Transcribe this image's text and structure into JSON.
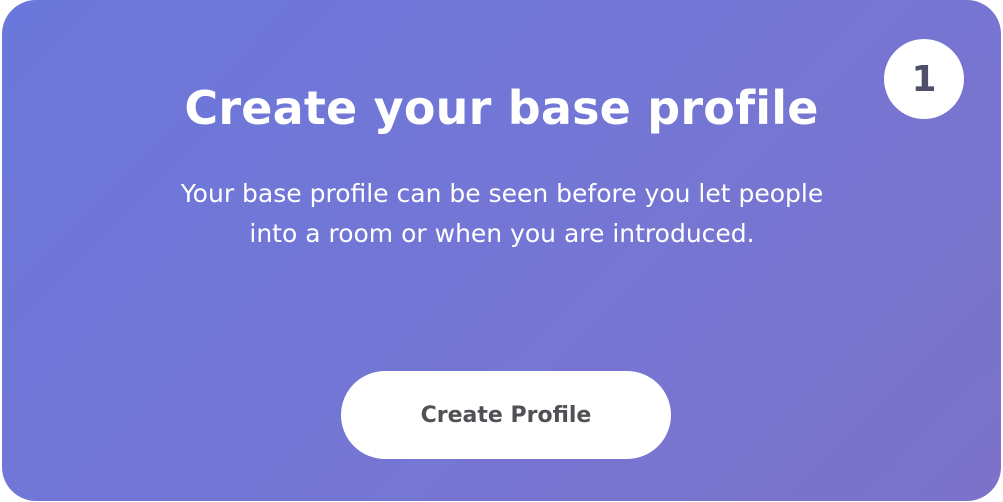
{
  "card": {
    "step_number": "1",
    "title": "Create your base profile",
    "description": "Your base profile can be seen before you let people into a room or when you are introduced.",
    "button_label": "Create Profile"
  },
  "colors": {
    "card_gradient_start": "#6a78db",
    "card_gradient_end": "#7c72ca",
    "text": "#ffffff",
    "button_bg": "#ffffff",
    "button_text": "#505055"
  }
}
